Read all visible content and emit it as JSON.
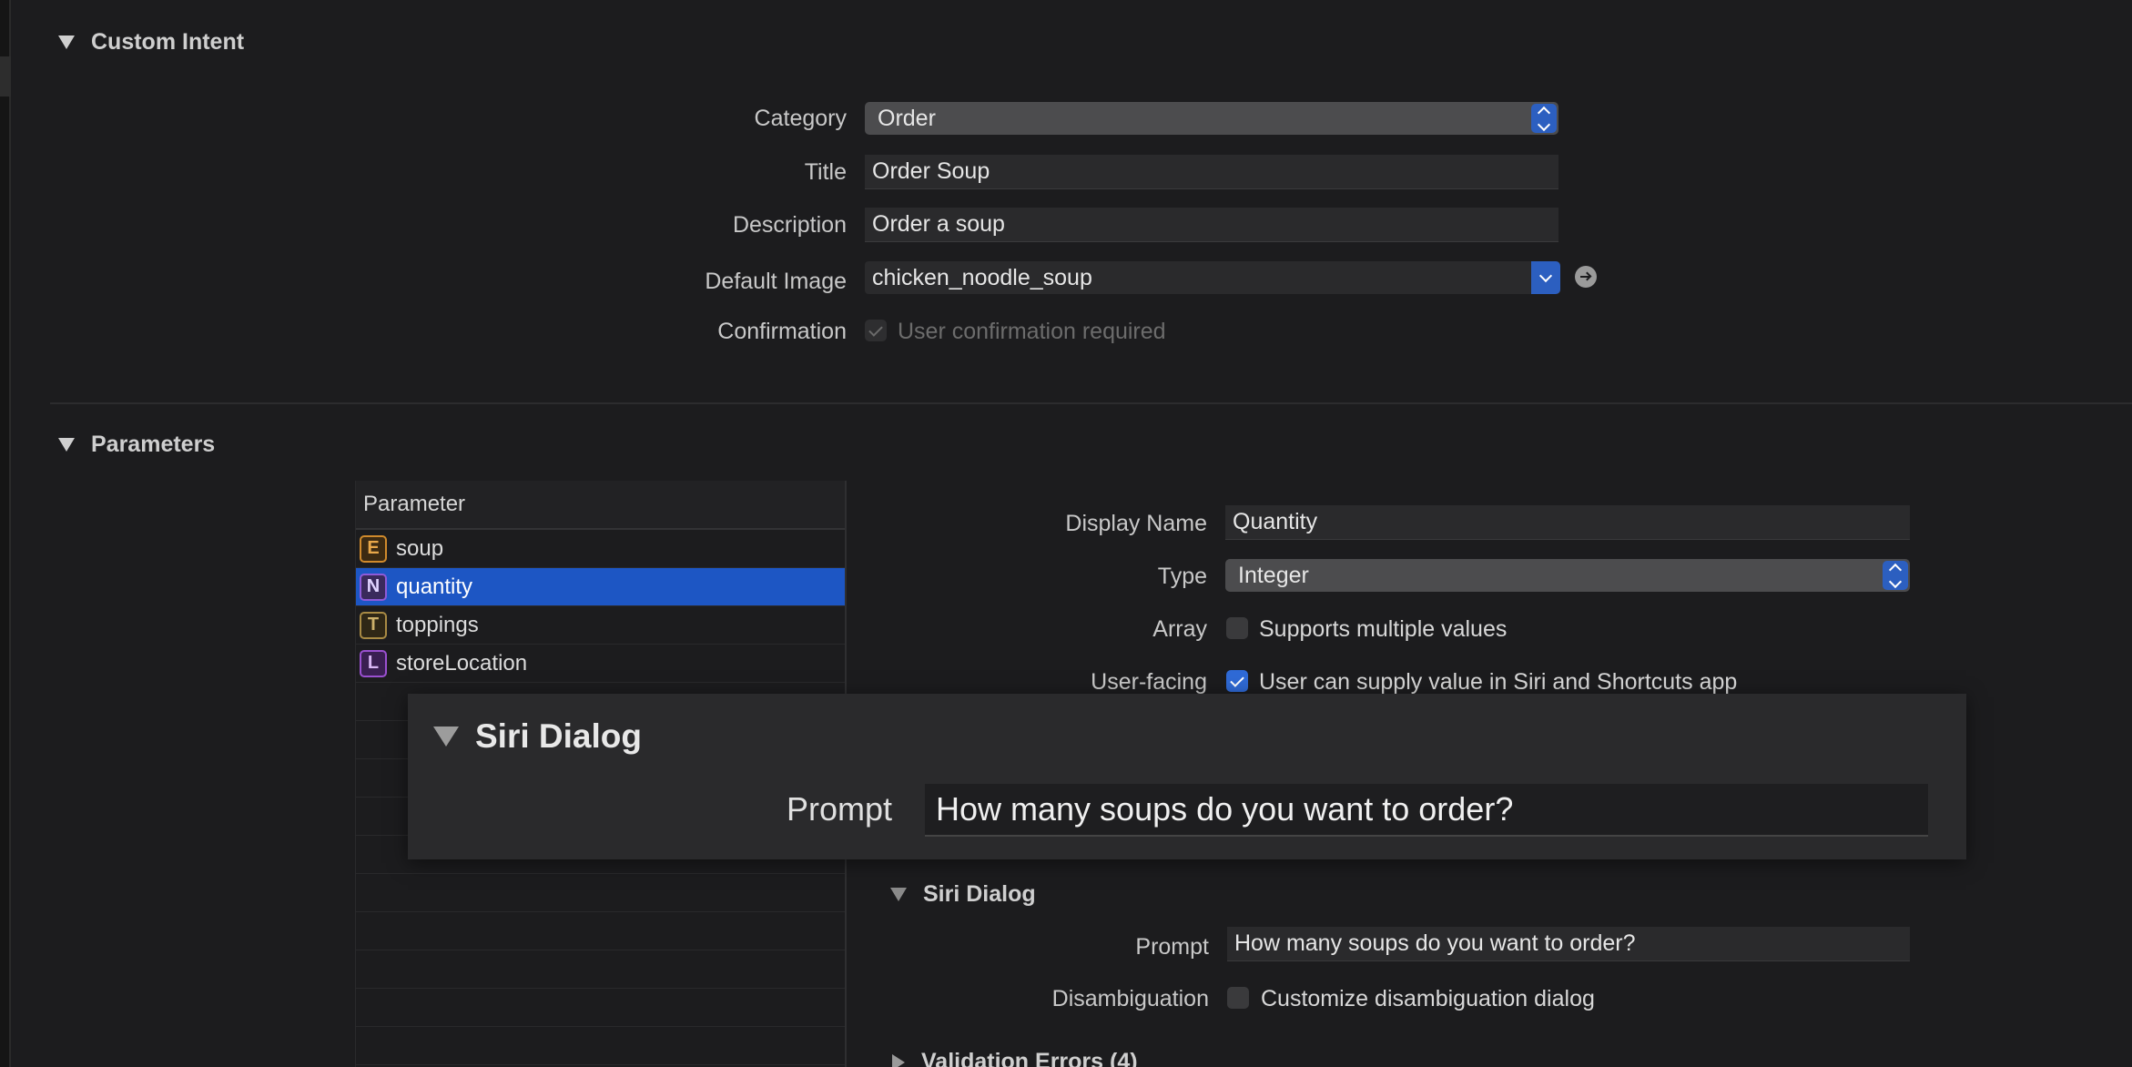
{
  "custom_intent": {
    "title": "Custom Intent",
    "category_label": "Category",
    "category_value": "Order",
    "title_label": "Title",
    "title_value": "Order Soup",
    "description_label": "Description",
    "description_value": "Order a soup",
    "default_image_label": "Default Image",
    "default_image_value": "chicken_noodle_soup",
    "confirmation_label": "Confirmation",
    "confirmation_text": "User confirmation required"
  },
  "parameters": {
    "title": "Parameters",
    "table_header": "Parameter",
    "items": [
      {
        "badge": "E",
        "name": "soup"
      },
      {
        "badge": "N",
        "name": "quantity"
      },
      {
        "badge": "T",
        "name": "toppings"
      },
      {
        "badge": "L",
        "name": "storeLocation"
      }
    ]
  },
  "detail": {
    "display_name_label": "Display Name",
    "display_name_value": "Quantity",
    "type_label": "Type",
    "type_value": "Integer",
    "array_label": "Array",
    "array_text": "Supports multiple values",
    "user_facing_label": "User-facing",
    "user_facing_text": "User can supply value in Siri and Shortcuts app",
    "siri_dialog_title": "Siri Dialog",
    "prompt_label": "Prompt",
    "prompt_value": "How many soups do you want to order?",
    "disambiguation_label": "Disambiguation",
    "disambiguation_text": "Customize disambiguation dialog",
    "validation_errors_title": "Validation Errors (4)"
  },
  "zoom": {
    "title": "Siri Dialog",
    "prompt_label": "Prompt",
    "prompt_value": "How many soups do you want to order?"
  },
  "colors": {
    "background": "#1c1c1e",
    "accent": "#2c5fc0",
    "selection": "#1d56c4"
  }
}
